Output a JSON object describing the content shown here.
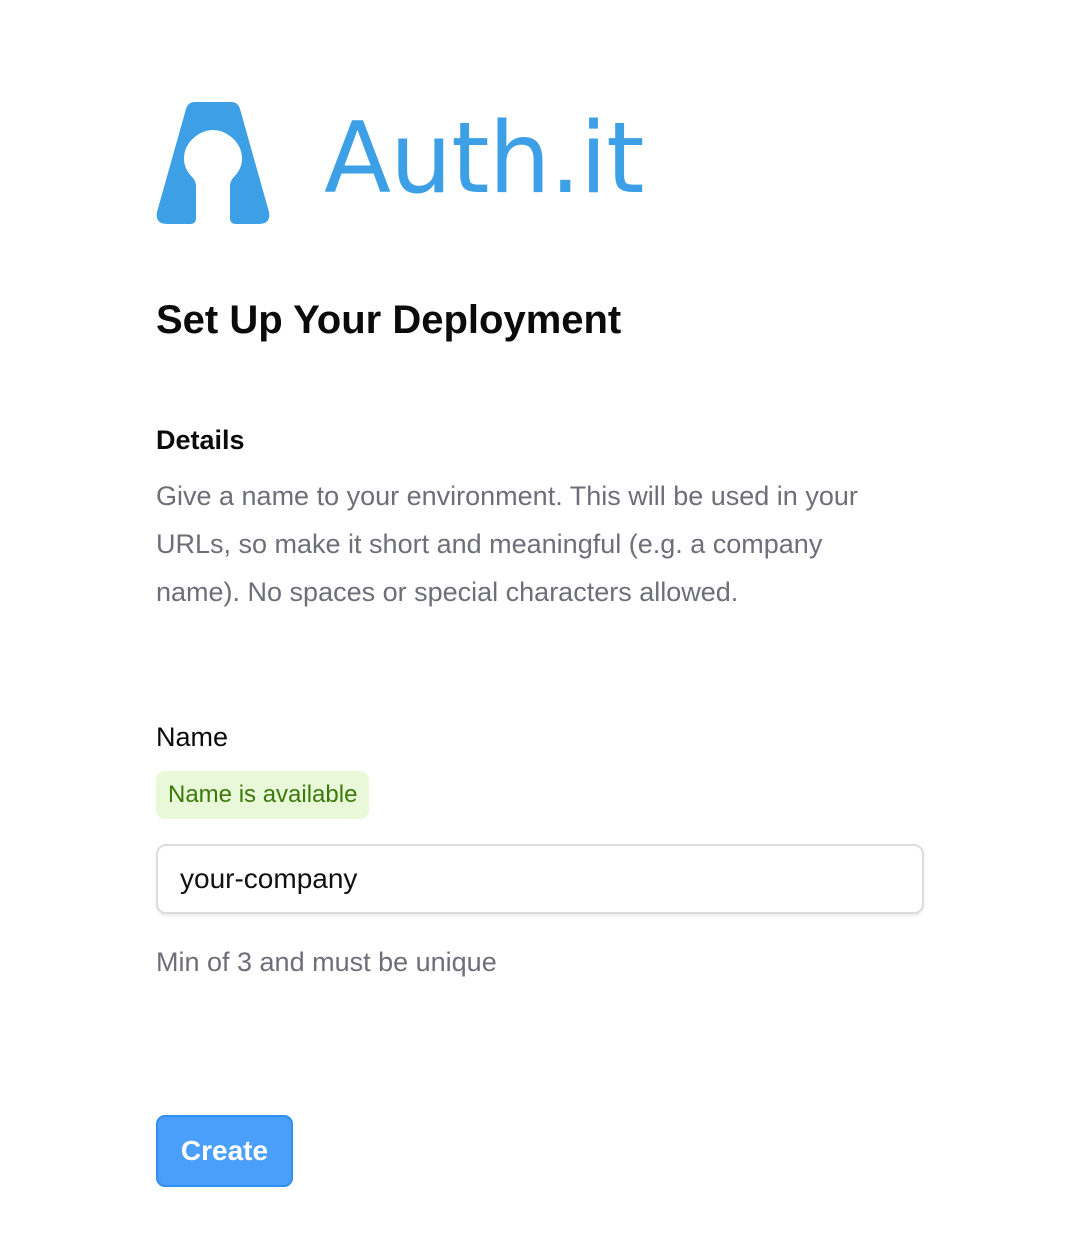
{
  "brand": {
    "name": "Auth.it",
    "logo_icon": "keyhole-a-logo-icon",
    "color": "#3d9fe6"
  },
  "page": {
    "title": "Set Up Your Deployment"
  },
  "details": {
    "title": "Details",
    "description": "Give a name to your environment. This will be used in your URLs, so make it short and meaningful (e.g. a company name). No spaces or special characters allowed."
  },
  "name_field": {
    "label": "Name",
    "status": "Name is available",
    "status_color": "#3b7a0a",
    "status_bg": "#e8f8d8",
    "value": "your-company",
    "hint": "Min of 3 and must be unique"
  },
  "actions": {
    "create_label": "Create",
    "create_color": "#4a9ffa"
  }
}
